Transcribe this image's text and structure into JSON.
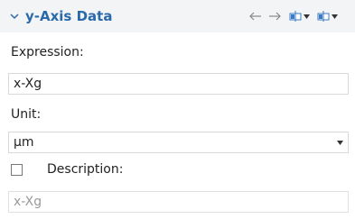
{
  "section": {
    "title": "y-Axis Data",
    "toolbar": {
      "back_icon": "arrow-left-icon",
      "forward_icon": "arrow-right-icon",
      "menu1_icon": "table-insert-icon",
      "menu2_icon": "table-insert-icon"
    }
  },
  "expression": {
    "label": "Expression:",
    "value": "x-Xg"
  },
  "unit": {
    "label": "Unit:",
    "value": "μm"
  },
  "description": {
    "label": "Description:",
    "checked": false,
    "value": "x-Xg"
  },
  "colors": {
    "accent": "#2a6aa8",
    "header_bg": "#f3f4f6",
    "border": "#d9d9d9",
    "disabled_text": "#9a9a9a"
  }
}
